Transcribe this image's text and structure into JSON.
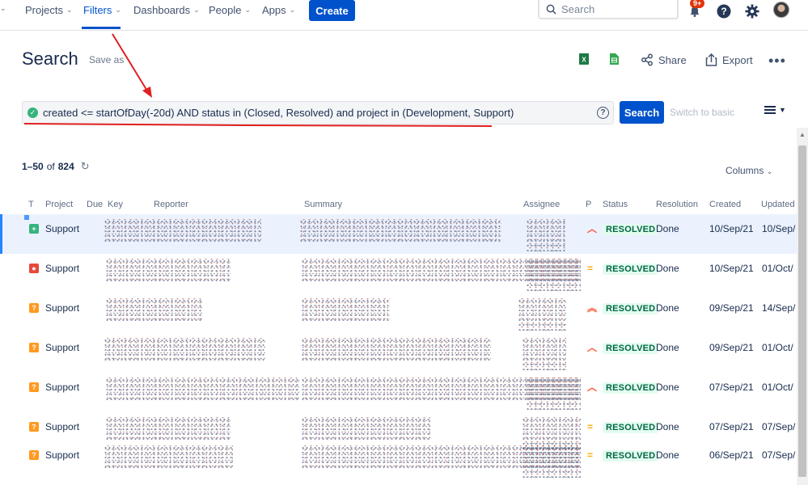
{
  "nav": {
    "items": [
      {
        "label": "Projects"
      },
      {
        "label": "Filters"
      },
      {
        "label": "Dashboards"
      },
      {
        "label": "People"
      },
      {
        "label": "Apps"
      }
    ],
    "create_label": "Create",
    "search_placeholder": "Search",
    "notifications_badge": "9+"
  },
  "header": {
    "title": "Search",
    "save_as": "Save as",
    "share_label": "Share",
    "export_label": "Export"
  },
  "jql": {
    "query": "created <= startOfDay(-20d) AND status in (Closed, Resolved) and project in (Development, Support)",
    "search_button": "Search",
    "switch_label": "Switch to basic"
  },
  "results": {
    "range": "1–50",
    "of": "of",
    "total": "824",
    "columns_label": "Columns"
  },
  "table": {
    "headers": {
      "t": "T",
      "project": "Project",
      "due": "Due",
      "key": "Key",
      "reporter": "Reporter",
      "summary": "Summary",
      "assignee": "Assignee",
      "p": "P",
      "status": "Status",
      "resolution": "Resolution",
      "created": "Created",
      "updated": "Updated"
    },
    "rows": [
      {
        "type": "new-feature",
        "project": "Support",
        "priority": "high",
        "status": "RESOLVED",
        "resolution": "Done",
        "created": "10/Sep/21",
        "updated": "10/Sep/"
      },
      {
        "type": "bug",
        "project": "Support",
        "priority": "medium",
        "status": "RESOLVED",
        "resolution": "Done",
        "created": "10/Sep/21",
        "updated": "01/Oct/"
      },
      {
        "type": "question",
        "project": "Support",
        "priority": "highest",
        "status": "RESOLVED",
        "resolution": "Done",
        "created": "09/Sep/21",
        "updated": "14/Sep/"
      },
      {
        "type": "question",
        "project": "Support",
        "priority": "high",
        "status": "RESOLVED",
        "resolution": "Done",
        "created": "09/Sep/21",
        "updated": "01/Oct/"
      },
      {
        "type": "question",
        "project": "Support",
        "priority": "high",
        "status": "RESOLVED",
        "resolution": "Done",
        "created": "07/Sep/21",
        "updated": "01/Oct/"
      },
      {
        "type": "question",
        "project": "Support",
        "priority": "medium",
        "status": "RESOLVED",
        "resolution": "Done",
        "created": "07/Sep/21",
        "updated": "07/Sep/"
      },
      {
        "type": "question",
        "project": "Support",
        "priority": "medium",
        "status": "RESOLVED",
        "resolution": "Done",
        "created": "06/Sep/21",
        "updated": "07/Sep/"
      }
    ]
  },
  "colors": {
    "brand": "#0052cc",
    "resolved_text": "#006644",
    "resolved_bg": "#e3fcef",
    "annotation": "#e02020"
  }
}
